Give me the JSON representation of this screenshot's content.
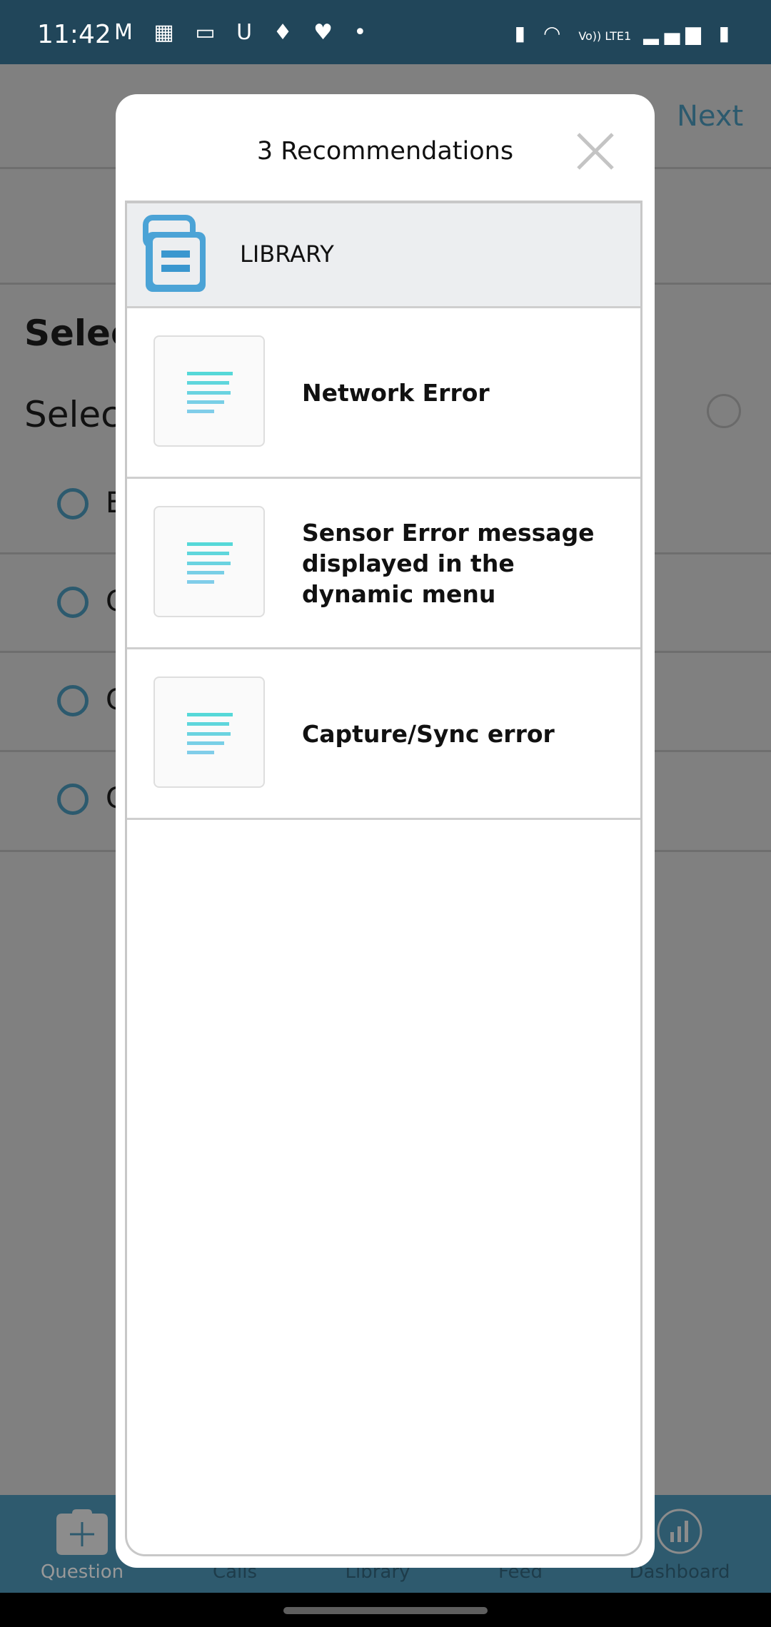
{
  "status_bar": {
    "time": "11:42",
    "notification_icons": [
      "gmail-icon",
      "calendar-icon",
      "zomato-icon",
      "u-app-icon",
      "swiggy-icon",
      "health-icon",
      "dot-icon"
    ],
    "system_icons": [
      "battery-saver-icon",
      "wifi-icon",
      "volte-icon",
      "signal-icon",
      "signal-icon",
      "battery-charging-icon"
    ],
    "volte_label": "Vo)) LTE1"
  },
  "background": {
    "next_label": "Next",
    "heading": "Selec",
    "subheading": "Selec",
    "options": [
      "E",
      "C",
      "C",
      "C"
    ]
  },
  "modal": {
    "title": "3 Recommendations",
    "section_label": "LIBRARY",
    "items": [
      {
        "label": "Network Error"
      },
      {
        "label": "Sensor Error message displayed in the dynamic menu"
      },
      {
        "label": "Capture/Sync error"
      }
    ],
    "colors": {
      "library_icon": "#4ba3d6",
      "doc_lines_top": "#56d8d8",
      "doc_lines_bottom": "#7fcfe8"
    }
  },
  "bottom_nav": {
    "items": [
      {
        "label": "Question"
      },
      {
        "label": "Calls"
      },
      {
        "label": "Library"
      },
      {
        "label": "Feed"
      },
      {
        "label": "Dashboard"
      }
    ]
  },
  "colors": {
    "status_bar": "#21465a",
    "nav": "#2e5a6e",
    "overlay": "#808080"
  }
}
